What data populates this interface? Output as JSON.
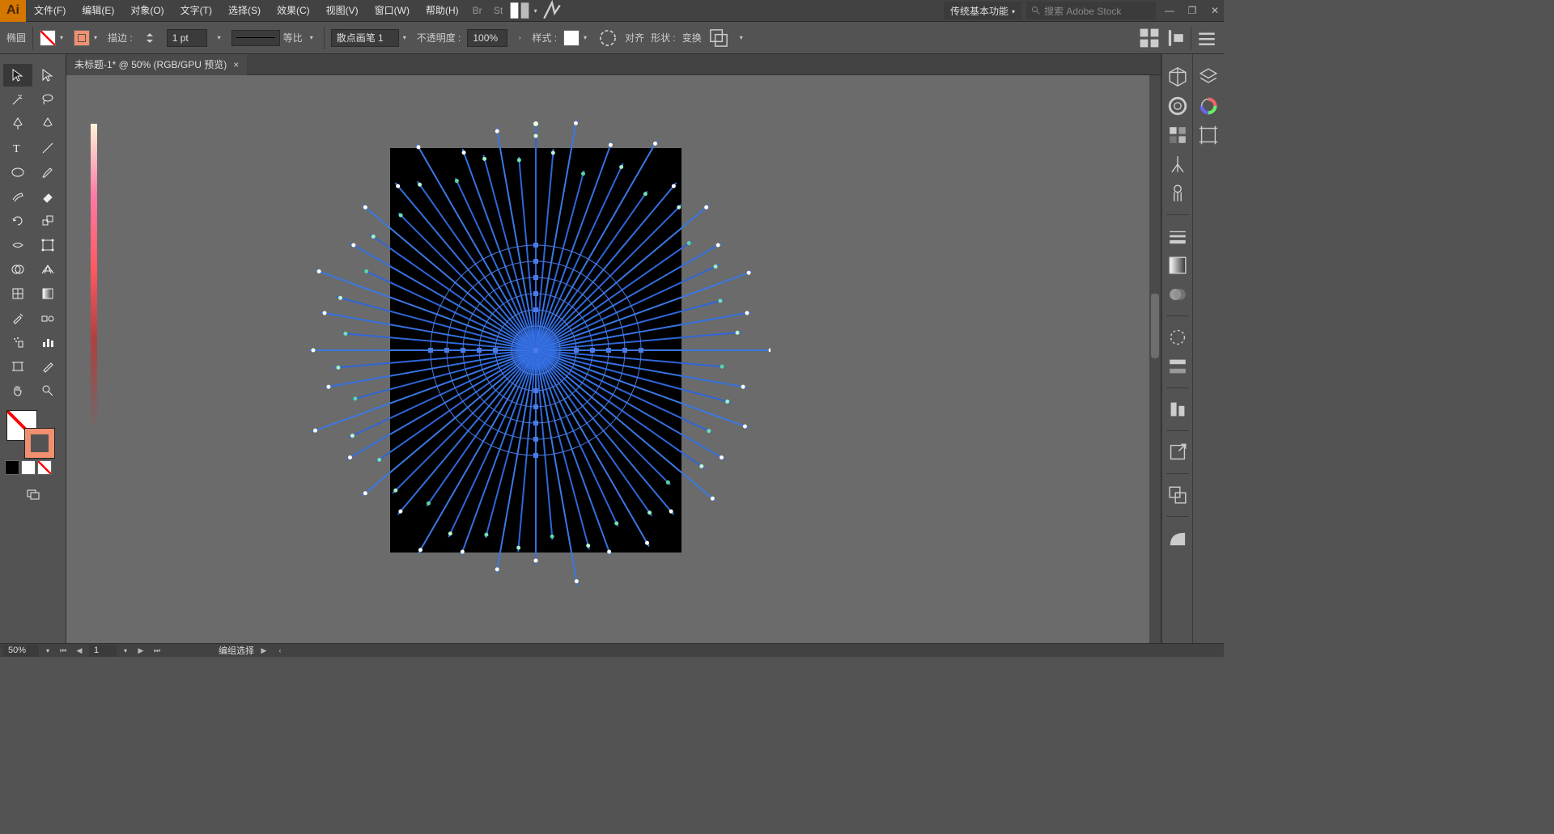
{
  "app_logo": "Ai",
  "menus": {
    "file": "文件(F)",
    "edit": "编辑(E)",
    "object": "对象(O)",
    "type": "文字(T)",
    "select": "选择(S)",
    "effect": "效果(C)",
    "view": "视图(V)",
    "window": "窗口(W)",
    "help": "帮助(H)"
  },
  "workspace_name": "传统基本功能",
  "search_placeholder": "搜索 Adobe Stock",
  "control": {
    "selection_type": "椭圆",
    "stroke_label": "描边 :",
    "stroke_weight": "1 pt",
    "profile_label": "等比",
    "brush_name": "散点画笔 1",
    "opacity_label": "不透明度 :",
    "opacity_value": "100%",
    "style_label": "样式 :",
    "align_label": "对齐",
    "shape_label": "形状 :",
    "transform_label": "变换"
  },
  "doc": {
    "tab_title": "未标题-1* @ 50% (RGB/GPU 预览)"
  },
  "status": {
    "zoom": "50%",
    "artboard_num": "1",
    "selection_info": "编组选择"
  },
  "right_panels": {
    "c1": [
      "3d",
      "cc",
      "grid",
      "branch",
      "club",
      "lines",
      "rect",
      "circle",
      "sun",
      "screens",
      "para",
      "export",
      "combine",
      "shapebuilder"
    ],
    "c2": [
      "layers",
      "swatches",
      "artboards"
    ]
  }
}
